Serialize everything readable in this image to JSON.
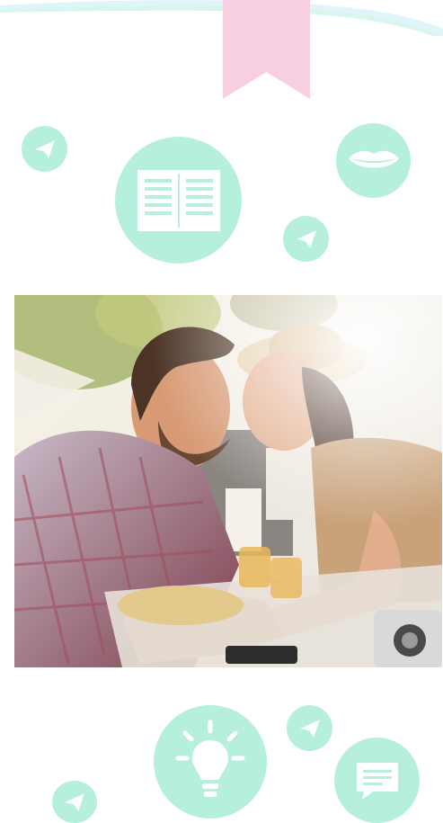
{
  "colors": {
    "mint": "#b6f0dc",
    "bookmark_pink": "#f8cfe0",
    "wave_light_blue": "#dff4fb",
    "wave_mint": "#d7f7ee",
    "background": "#ffffff"
  },
  "icons": {
    "top_section": [
      "paper-plane-icon",
      "book-icon",
      "lips-icon",
      "paper-plane-icon"
    ],
    "bottom_section": [
      "lightbulb-icon",
      "paper-plane-icon",
      "chat-bubble-icon",
      "paper-plane-icon"
    ]
  },
  "decorations": [
    "top-wave",
    "bookmark-ribbon"
  ],
  "photo": {
    "subject": "couple-at-cafe-photo"
  }
}
